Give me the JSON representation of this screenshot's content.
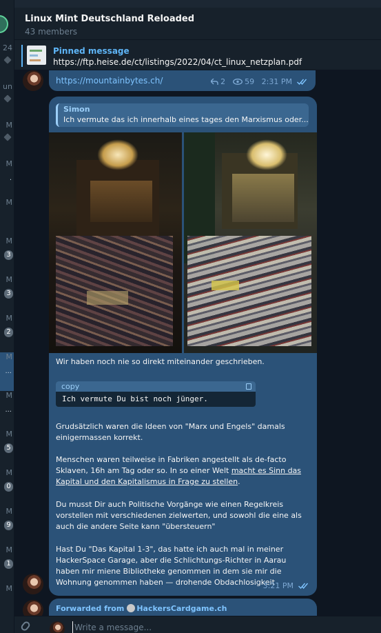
{
  "header": {
    "title": "Linux Mint Deutschland Reloaded",
    "members": "43 members"
  },
  "pinned": {
    "label": "Pinned message",
    "text": "https://ftp.heise.de/ct/listings/2022/04/ct_linux_netzplan.pdf"
  },
  "chat_list": {
    "rows": [
      {
        "time": "24",
        "badge": "",
        "pinned": true
      },
      {
        "time": "un",
        "badge": "",
        "pinned": true
      },
      {
        "time": "M",
        "badge": "",
        "pinned": true
      },
      {
        "time": "M",
        "badge": "",
        "dots": "."
      },
      {
        "time": "M",
        "badge": ""
      },
      {
        "time": "M",
        "badge": "3"
      },
      {
        "time": "M",
        "badge": "3"
      },
      {
        "time": "M",
        "badge": "2"
      },
      {
        "time": "M",
        "badge": "",
        "dots": "...",
        "selected": true
      },
      {
        "time": "M",
        "badge": "",
        "dots": "..."
      },
      {
        "time": "M",
        "badge": "5"
      },
      {
        "time": "M",
        "badge": "0"
      },
      {
        "time": "M",
        "badge": "9"
      },
      {
        "time": "M",
        "badge": "1"
      },
      {
        "time": "M",
        "badge": ""
      }
    ]
  },
  "messages": {
    "link": {
      "url": "https://mountainbytes.ch/",
      "replies": "2",
      "views": "59",
      "time": "2:31 PM"
    },
    "main": {
      "reply_name": "Simon",
      "reply_text": "Ich vermute das ich innerhalb eines tages den Marxismus oder...",
      "line1": "Wir haben noch nie so direkt miteinander geschrieben.",
      "code_label": "copy",
      "code_text": "Ich vermute Du bist noch jünger.",
      "p1": "Grudsätzlich waren die Ideen von \"Marx und Engels\" damals einigermassen korrekt.",
      "p2_a": "Menschen waren teilweise in Fabriken angestellt als de-facto Sklaven, 16h am Tag oder so. In so einer Welt ",
      "p2_link": "macht es Sinn das Kapital und den Kapitalismus in Frage zu stellen",
      "p2_b": ".",
      "p3": "Du musst Dir auch Politische Vorgänge wie einen Regelkreis vorstellen mit verschiedenen zielwerten, und sowohl die eine als auch die andere Seite kann \"übersteuern\"",
      "p4": "Hast Du \"Das Kapital 1-3\", das hatte ich auch mal in meiner HackerSpace Garage, aber die Schlichtungs-Richter in Aarau haben mir miene Bibliotheke genommen in dem sie mir die Wohnung genommen haben — drohende Obdachlosigkeit",
      "time": "3:21 PM"
    },
    "forwarded": {
      "prefix": "Forwarded from",
      "source": "HackersCardgame.ch"
    }
  },
  "composer": {
    "placeholder": "Write a message..."
  },
  "colors": {
    "accent": "#5eb5f7",
    "bubble": "#2b5278",
    "background": "#0e1621"
  }
}
